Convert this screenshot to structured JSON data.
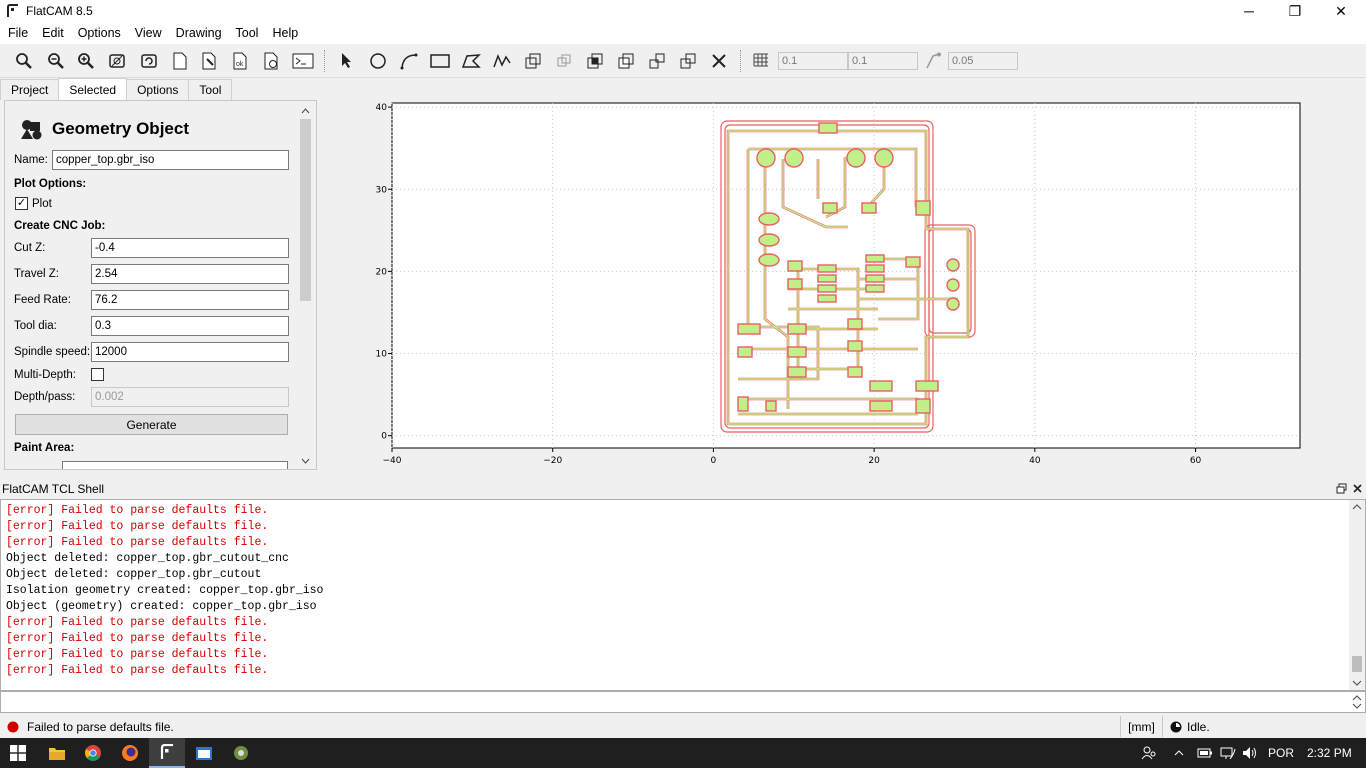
{
  "window": {
    "title": "FlatCAM 8.5",
    "minimize": "─",
    "restore": "❐",
    "close": "✕"
  },
  "menu": [
    "File",
    "Edit",
    "Options",
    "View",
    "Drawing",
    "Tool",
    "Help"
  ],
  "toolbar": {
    "grid_x": "0.1",
    "grid_y": "0.1",
    "snap_max": "0.05"
  },
  "tabs": [
    "Project",
    "Selected",
    "Options",
    "Tool"
  ],
  "active_tab": "Selected",
  "panel": {
    "heading": "Geometry Object",
    "name_label": "Name:",
    "name_value": "copper_top.gbr_iso",
    "plot_options": "Plot Options:",
    "plot_label": "Plot",
    "plot_checked": "✓",
    "cnc_heading": "Create CNC Job:",
    "cutz_label": "Cut Z:",
    "cutz_value": "-0.4",
    "travelz_label": "Travel Z:",
    "travelz_value": "2.54",
    "feed_label": "Feed Rate:",
    "feed_value": "76.2",
    "tooldia_label": "Tool dia:",
    "tooldia_value": "0.3",
    "spindle_label": "Spindle speed:",
    "spindle_value": "12000",
    "multidepth_label": "Multi-Depth:",
    "depthpass_label": "Depth/pass:",
    "depthpass_value": "0.002",
    "generate_label": "Generate",
    "paint_heading": "Paint Area:"
  },
  "plot": {
    "x_ticks": [
      "−40",
      "−20",
      "0",
      "20",
      "40",
      "60"
    ],
    "y_ticks": [
      "40",
      "30",
      "20",
      "10",
      "0"
    ],
    "xlim": [
      -40,
      73
    ],
    "ylim": [
      -1.5,
      40.5
    ]
  },
  "shell": {
    "title": "FlatCAM TCL Shell",
    "lines": [
      {
        "text": "[error] Failed to parse defaults file.",
        "error": true
      },
      {
        "text": "[error] Failed to parse defaults file.",
        "error": true
      },
      {
        "text": "[error] Failed to parse defaults file.",
        "error": true
      },
      {
        "text": "Object deleted: copper_top.gbr_cutout_cnc",
        "error": false
      },
      {
        "text": "Object deleted: copper_top.gbr_cutout",
        "error": false
      },
      {
        "text": "Isolation geometry created: copper_top.gbr_iso",
        "error": false
      },
      {
        "text": "Object (geometry) created: copper_top.gbr_iso",
        "error": false
      },
      {
        "text": "[error] Failed to parse defaults file.",
        "error": true
      },
      {
        "text": "[error] Failed to parse defaults file.",
        "error": true
      },
      {
        "text": "[error] Failed to parse defaults file.",
        "error": true
      },
      {
        "text": "[error] Failed to parse defaults file.",
        "error": true
      }
    ]
  },
  "status": {
    "message": "Failed to parse defaults file.",
    "units": "[mm]",
    "state": "Idle."
  },
  "taskbar": {
    "language": "POR",
    "time": "2:32 PM"
  },
  "colors": {
    "error": "#d00000",
    "pcb_fill": "#c2ef8a",
    "pcb_outline": "#e86060",
    "status_dot": "#d00000"
  }
}
